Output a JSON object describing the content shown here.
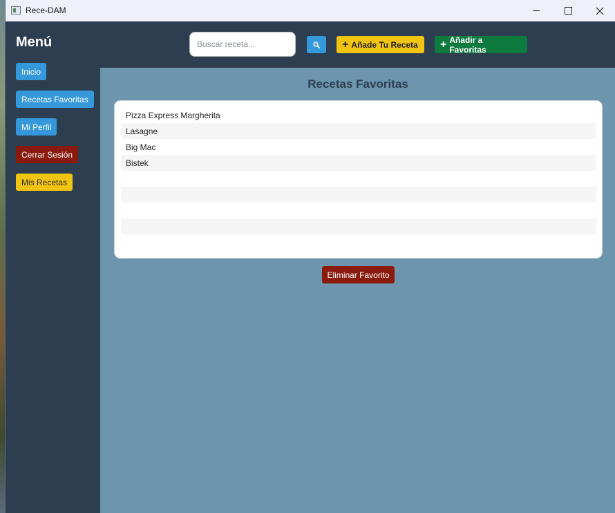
{
  "window": {
    "title": "Rece-DAM"
  },
  "sidebar": {
    "title": "Menú",
    "items": [
      {
        "label": "Inicio",
        "color": "#3498db"
      },
      {
        "label": "Recetas Favoritas",
        "color": "#3498db"
      },
      {
        "label": "Mi Perfil",
        "color": "#3498db"
      },
      {
        "label": "Cerrar Sesión",
        "color": "#8b1a0e"
      },
      {
        "label": "Mis Recetas",
        "color": "#f1c40f"
      }
    ]
  },
  "header": {
    "search_placeholder": "Buscar receta...",
    "search_value": "",
    "add_recipe_label": "Añade Tu Receta",
    "add_favorite_label": "Añadir a Favoritas"
  },
  "main": {
    "title": "Recetas Favoritas",
    "favorites": [
      "Pizza Express Margherita",
      "Lasagne",
      "Big Mac",
      "Bistek",
      "",
      "",
      "",
      "",
      ""
    ],
    "delete_label": "Eliminar Favorito"
  },
  "colors": {
    "sidebar_bg": "#2c3e50",
    "main_bg": "#6d95ad",
    "primary_blue": "#3498db",
    "danger_red": "#8b1a0e",
    "warning_yellow": "#f1c40f",
    "success_green": "#0f7a3e"
  },
  "icons": {
    "search": "search-icon",
    "plus": "plus-icon",
    "minimize": "minimize-icon",
    "maximize": "maximize-icon",
    "close": "close-icon"
  }
}
